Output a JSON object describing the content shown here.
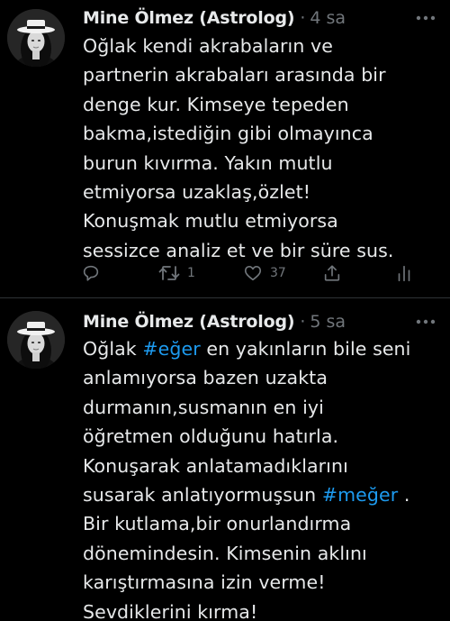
{
  "tweets": [
    {
      "author": "Mine Ölmez (Astrolog)",
      "separator": "·",
      "time": "4 sa",
      "lines": [
        "Oğlak kendi akrabaların ve",
        "partnerin akrabaları arasında bir",
        "denge kur. Kimseye tepeden",
        "bakma,istediğin gibi olmayınca",
        "burun kıvırma. Yakın mutlu",
        "etmiyorsa uzaklaş,özlet!",
        "Konuşmak mutlu etmiyorsa",
        "sessizce analiz et ve bir süre sus."
      ],
      "actions": {
        "retweet_count": "1",
        "like_count": "37"
      }
    },
    {
      "author": "Mine Ölmez (Astrolog)",
      "separator": "·",
      "time": "5 sa",
      "lines": {
        "l1_pre": "Oğlak ",
        "l1_hashtag": "#eğer",
        "l1_post": " en yakınların bile seni",
        "l2": "anlamıyorsa bazen uzakta",
        "l3": "durmanın,susmanın en iyi",
        "l4": "öğretmen olduğunu hatırla.",
        "l5": "Konuşarak anlatamadıklarını",
        "l6_pre": "susarak anlatıyormuşsun ",
        "l6_hashtag": "#meğer",
        "l6_post": " .",
        "l7": "Bir kutlama,bir onurlandırma",
        "l8": "dönemindesin. Kimsenin aklını",
        "l9": "karıştırmasına izin verme!",
        "l10": "Sevdiklerini kırma!"
      }
    }
  ],
  "colors": {
    "background": "#000000",
    "text": "#e7e9ea",
    "muted": "#71767b",
    "link": "#1d9bf0",
    "divider": "#2f3336"
  },
  "icons": {
    "reply": "speech-bubble-icon",
    "retweet": "retweet-arrows-icon",
    "like": "heart-icon",
    "share": "share-upload-icon",
    "analytics": "bar-chart-icon",
    "more": "ellipsis-icon"
  }
}
